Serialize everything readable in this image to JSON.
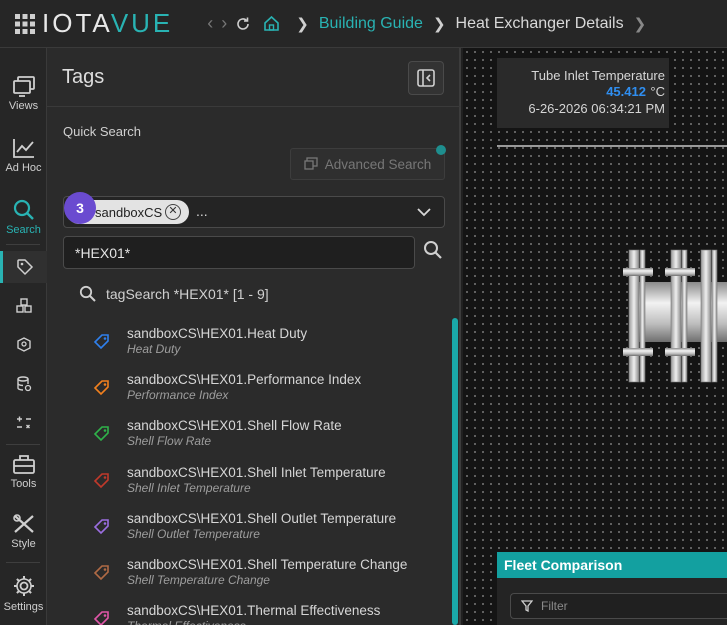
{
  "brand": {
    "part1": "IOTA",
    "part2": "VUE"
  },
  "breadcrumb": {
    "link": "Building Guide",
    "current": "Heat Exchanger Details"
  },
  "rail": {
    "views": "Views",
    "adhoc": "Ad Hoc",
    "search": "Search",
    "tools": "Tools",
    "style": "Style",
    "settings": "Settings"
  },
  "panel": {
    "title": "Tags",
    "quick_search_label": "Quick Search",
    "advanced_search": "Advanced Search",
    "chip_label": "sandboxCS",
    "chip_more": "...",
    "badge": "3",
    "search_value": "*HEX01*",
    "results_header": "tagSearch *HEX01* [1 - 9]",
    "tags": [
      {
        "name": "sandboxCS\\HEX01.Heat Duty",
        "desc": "Heat Duty",
        "color": "#2f80ed"
      },
      {
        "name": "sandboxCS\\HEX01.Performance Index",
        "desc": "Performance Index",
        "color": "#f2801e"
      },
      {
        "name": "sandboxCS\\HEX01.Shell Flow Rate",
        "desc": "Shell Flow Rate",
        "color": "#2fb34a"
      },
      {
        "name": "sandboxCS\\HEX01.Shell Inlet Temperature",
        "desc": "Shell Inlet Temperature",
        "color": "#c0392b"
      },
      {
        "name": "sandboxCS\\HEX01.Shell Outlet Temperature",
        "desc": "Shell Outlet Temperature",
        "color": "#9b6ee0"
      },
      {
        "name": "sandboxCS\\HEX01.Shell Temperature Change",
        "desc": "Shell Temperature Change",
        "color": "#b06a45"
      },
      {
        "name": "sandboxCS\\HEX01.Thermal Effectiveness",
        "desc": "Thermal Effectiveness",
        "color": "#e056a8"
      }
    ]
  },
  "canvas": {
    "tile_title": "Tube Inlet Temperature",
    "tile_value": "45.412",
    "tile_unit": "°C",
    "tile_time": "6-26-2026 06:34:21 PM",
    "fleet_title": "Fleet Comparison",
    "filter_placeholder": "Filter"
  }
}
